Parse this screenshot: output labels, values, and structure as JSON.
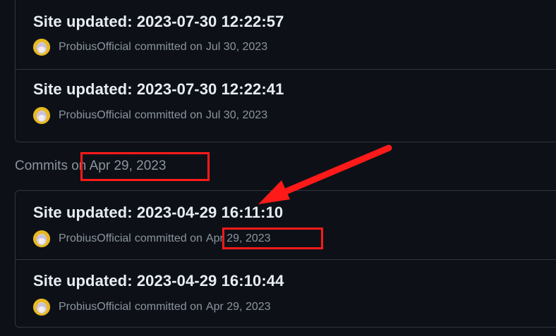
{
  "groups": [
    {
      "heading": "",
      "commits": [
        {
          "title": "Site updated: 2023-07-30 12:22:57",
          "author": "ProbiusOfficial",
          "action": "committed on",
          "date": "Jul 30, 2023"
        },
        {
          "title": "Site updated: 2023-07-30 12:22:41",
          "author": "ProbiusOfficial",
          "action": "committed on",
          "date": "Jul 30, 2023"
        }
      ]
    },
    {
      "heading_prefix": "Commits on",
      "heading_date": "Apr 29, 2023",
      "commits": [
        {
          "title": "Site updated: 2023-04-29 16:11:10",
          "author": "ProbiusOfficial",
          "action": "committed on",
          "date": "Apr 29, 2023"
        },
        {
          "title": "Site updated: 2023-04-29 16:10:44",
          "author": "ProbiusOfficial",
          "action": "committed on",
          "date": "Apr 29, 2023"
        }
      ]
    }
  ],
  "colors": {
    "background": "#0d1117",
    "border": "#30363d",
    "title": "#e6edf3",
    "muted": "#8b949e",
    "annotation": "#ff1a1a"
  },
  "annotation_icon": "red-arrow-icon",
  "avatar_icon": "avatar-icon"
}
